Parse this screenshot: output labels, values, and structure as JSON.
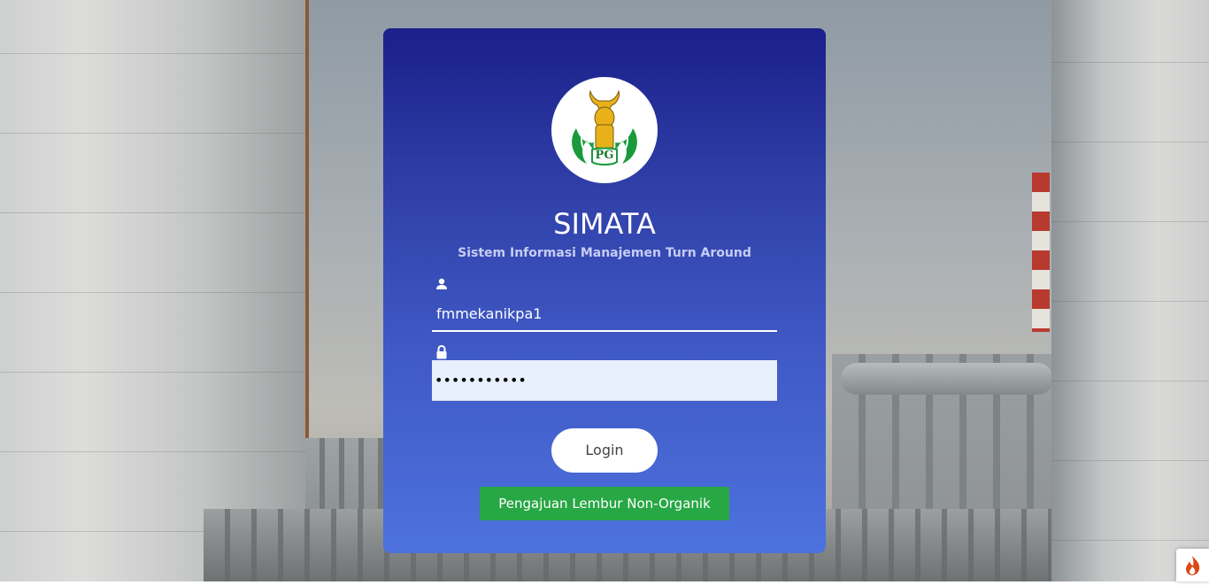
{
  "app": {
    "title": "SIMATA",
    "subtitle": "Sistem Informasi Manajemen Turn Around",
    "logo_text": "PG"
  },
  "form": {
    "username": {
      "icon": "user-icon",
      "value": "fmmekanikpa1"
    },
    "password": {
      "icon": "lock-icon",
      "value": "fmmekanikpa"
    },
    "login_label": "Login",
    "lembur_label": "Pengajuan Lembur Non-Organik"
  },
  "debug_badge": {
    "icon": "flame-icon"
  },
  "colors": {
    "card_top": "#1b1f8a",
    "card_bottom": "#4d72de",
    "lembur_button": "#28a745",
    "password_fill": "#e8f0fe"
  }
}
